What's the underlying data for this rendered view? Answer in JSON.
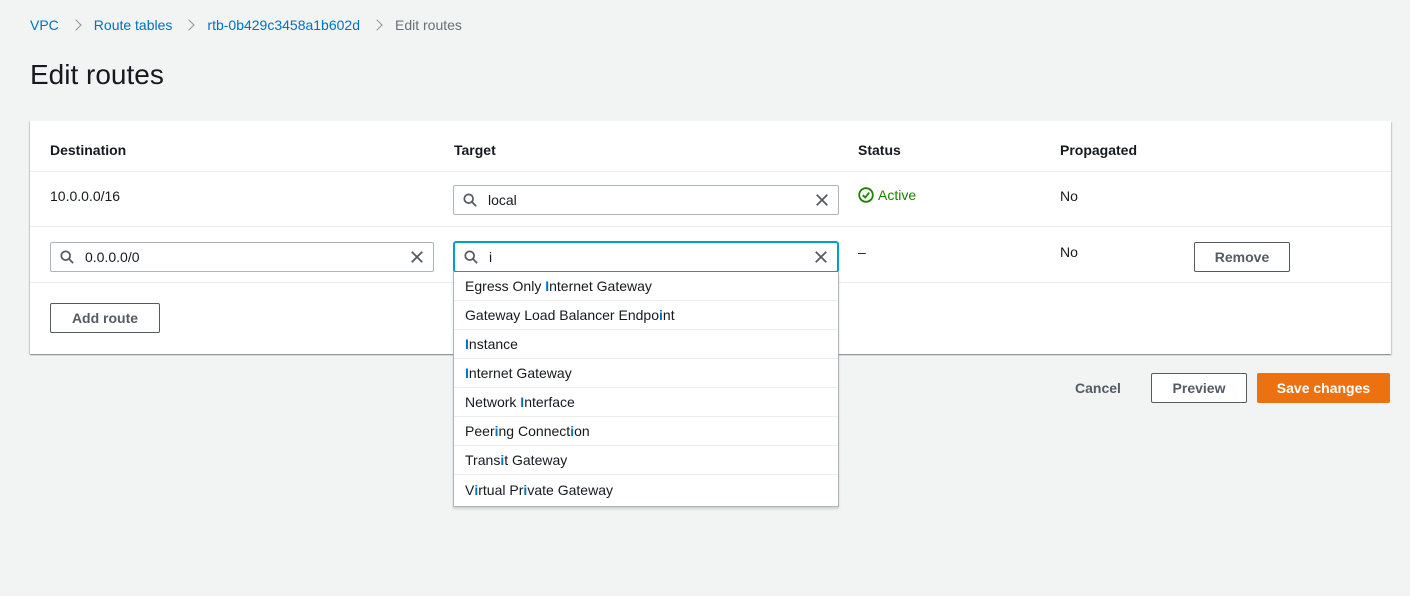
{
  "breadcrumb": {
    "items": [
      "VPC",
      "Route tables",
      "rtb-0b429c3458a1b602d"
    ],
    "current": "Edit routes"
  },
  "page_title": "Edit routes",
  "table": {
    "headers": {
      "destination": "Destination",
      "target": "Target",
      "status": "Status",
      "propagated": "Propagated"
    },
    "rows": [
      {
        "destination": "10.0.0.0/16",
        "target": "local",
        "status": "Active",
        "propagated": "No"
      },
      {
        "destination": "0.0.0.0/0",
        "target": "i",
        "status": "–",
        "propagated": "No",
        "remove_label": "Remove"
      }
    ]
  },
  "add_route_label": "Add route",
  "target_options": [
    {
      "label": "Egress Only Internet Gateway"
    },
    {
      "label": "Gateway Load Balancer Endpoint"
    },
    {
      "label": "Instance"
    },
    {
      "label": "Internet Gateway"
    },
    {
      "label": "Network Interface"
    },
    {
      "label": "Peering Connection"
    },
    {
      "label": "Transit Gateway"
    },
    {
      "label": "Virtual Private Gateway"
    }
  ],
  "filter_text": "i",
  "footer": {
    "cancel": "Cancel",
    "preview": "Preview",
    "save": "Save changes"
  },
  "icons": {
    "search": "search-icon",
    "clear": "close-icon",
    "status": "check-circle-icon",
    "separator": "chevron-right-icon"
  },
  "colors": {
    "link": "#0073bb",
    "primary": "#ec7211",
    "success": "#1d8102",
    "focus": "#00a1c9"
  }
}
